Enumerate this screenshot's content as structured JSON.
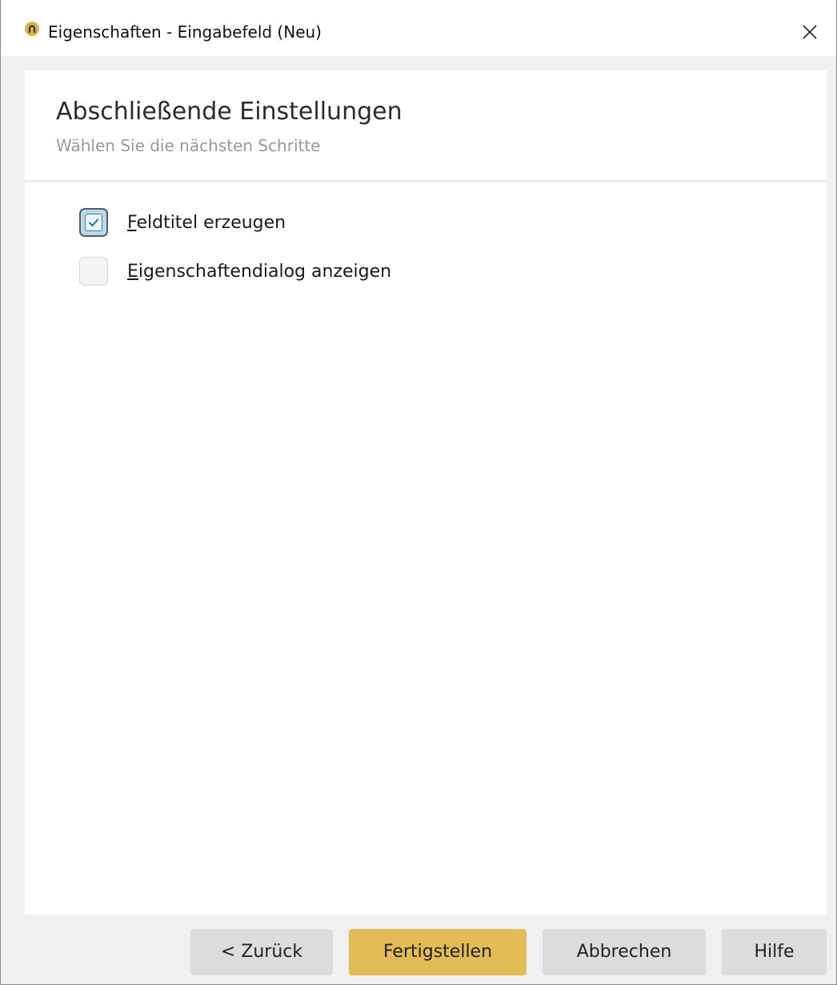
{
  "window": {
    "title": "Eigenschaften - Eingabefeld (Neu)",
    "app_icon": "app-logo-icon",
    "close_icon": "close-icon",
    "accent_color": "#e3bc57"
  },
  "header": {
    "title": "Abschließende Einstellungen",
    "subtitle": "Wählen Sie die nächsten Schritte"
  },
  "options": [
    {
      "mnemonic": "F",
      "rest": "eldtitel erzeugen",
      "checked": true
    },
    {
      "mnemonic": "E",
      "rest": "igenschaftendialog anzeigen",
      "checked": false
    }
  ],
  "buttons": {
    "back": "< Zurück",
    "finish": "Fertigstellen",
    "cancel": "Abbrechen",
    "help": "Hilfe"
  }
}
